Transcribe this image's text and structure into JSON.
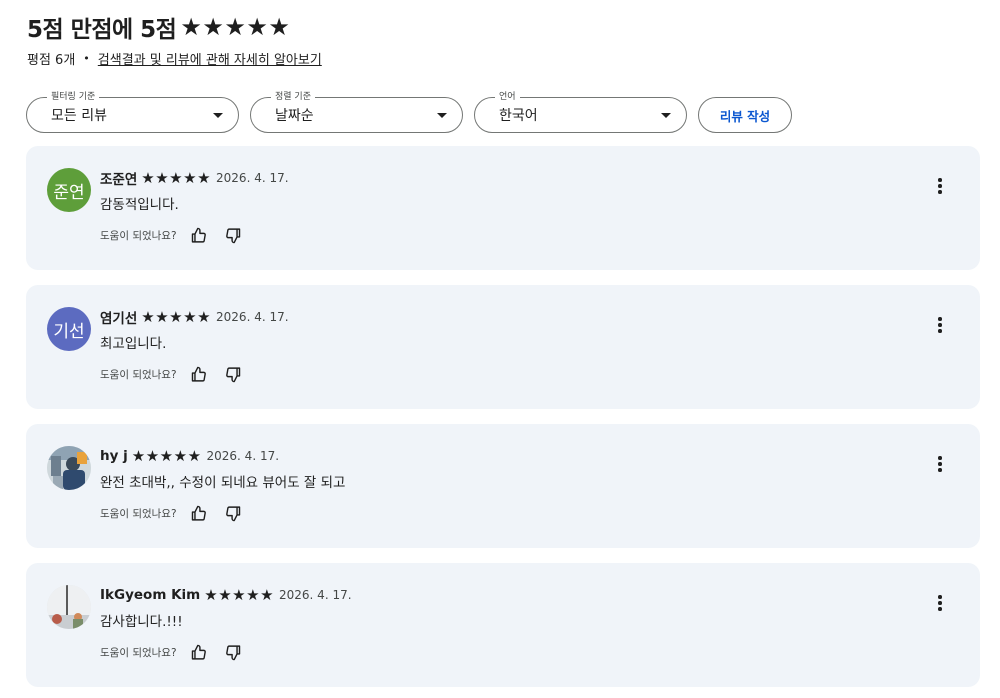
{
  "header": {
    "title": "5점 만점에 5점",
    "title_stars": 5,
    "review_count": "평점 6개",
    "separator": "•",
    "info_link": "검색결과 및 리뷰에 관해 자세히 알아보기"
  },
  "filters": [
    {
      "label": "필터링 기준",
      "value": "모든 리뷰"
    },
    {
      "label": "정렬 기준",
      "value": "날짜순"
    },
    {
      "label": "언어",
      "value": "한국어"
    }
  ],
  "write_button": "리뷰 작성",
  "star_glyph": "★",
  "helpful_label": "도움이 되었나요?",
  "reviews": [
    {
      "author": "조준연",
      "avatar_text": "준연",
      "avatar_color": "#5e9e3a",
      "rating": 5,
      "date": "2026. 4. 17.",
      "text": "감동적입니다."
    },
    {
      "author": "염기선",
      "avatar_text": "기선",
      "avatar_color": "#5c6bc0",
      "rating": 5,
      "date": "2026. 4. 17.",
      "text": "최고입니다."
    },
    {
      "author": "hy j",
      "avatar_text": "",
      "avatar_color": "#b9c3cc",
      "rating": 5,
      "date": "2026. 4. 17.",
      "text": "완전 초대박,, 수정이 되네요 뷰어도 잘 되고"
    },
    {
      "author": "IkGyeom Kim",
      "avatar_text": "",
      "avatar_color": "#e4e7ea",
      "rating": 5,
      "date": "2026. 4. 17.",
      "text": "감사합니다.!!!"
    }
  ]
}
